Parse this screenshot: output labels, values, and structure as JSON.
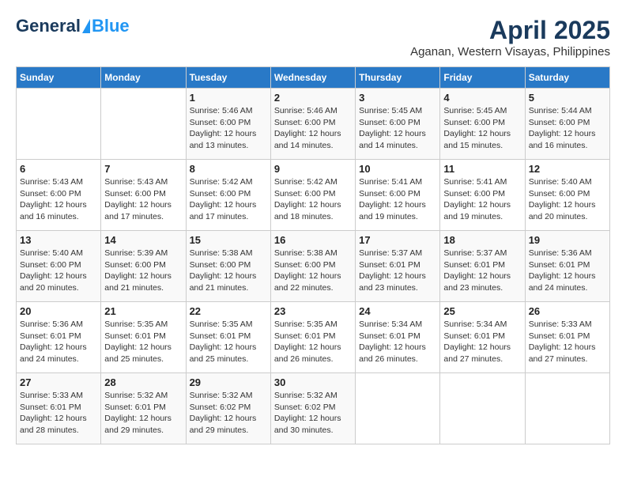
{
  "logo": {
    "part1": "General",
    "part2": "Blue"
  },
  "title": "April 2025",
  "subtitle": "Aganan, Western Visayas, Philippines",
  "headers": [
    "Sunday",
    "Monday",
    "Tuesday",
    "Wednesday",
    "Thursday",
    "Friday",
    "Saturday"
  ],
  "weeks": [
    [
      {
        "day": "",
        "info": ""
      },
      {
        "day": "",
        "info": ""
      },
      {
        "day": "1",
        "info": "Sunrise: 5:46 AM\nSunset: 6:00 PM\nDaylight: 12 hours\nand 13 minutes."
      },
      {
        "day": "2",
        "info": "Sunrise: 5:46 AM\nSunset: 6:00 PM\nDaylight: 12 hours\nand 14 minutes."
      },
      {
        "day": "3",
        "info": "Sunrise: 5:45 AM\nSunset: 6:00 PM\nDaylight: 12 hours\nand 14 minutes."
      },
      {
        "day": "4",
        "info": "Sunrise: 5:45 AM\nSunset: 6:00 PM\nDaylight: 12 hours\nand 15 minutes."
      },
      {
        "day": "5",
        "info": "Sunrise: 5:44 AM\nSunset: 6:00 PM\nDaylight: 12 hours\nand 16 minutes."
      }
    ],
    [
      {
        "day": "6",
        "info": "Sunrise: 5:43 AM\nSunset: 6:00 PM\nDaylight: 12 hours\nand 16 minutes."
      },
      {
        "day": "7",
        "info": "Sunrise: 5:43 AM\nSunset: 6:00 PM\nDaylight: 12 hours\nand 17 minutes."
      },
      {
        "day": "8",
        "info": "Sunrise: 5:42 AM\nSunset: 6:00 PM\nDaylight: 12 hours\nand 17 minutes."
      },
      {
        "day": "9",
        "info": "Sunrise: 5:42 AM\nSunset: 6:00 PM\nDaylight: 12 hours\nand 18 minutes."
      },
      {
        "day": "10",
        "info": "Sunrise: 5:41 AM\nSunset: 6:00 PM\nDaylight: 12 hours\nand 19 minutes."
      },
      {
        "day": "11",
        "info": "Sunrise: 5:41 AM\nSunset: 6:00 PM\nDaylight: 12 hours\nand 19 minutes."
      },
      {
        "day": "12",
        "info": "Sunrise: 5:40 AM\nSunset: 6:00 PM\nDaylight: 12 hours\nand 20 minutes."
      }
    ],
    [
      {
        "day": "13",
        "info": "Sunrise: 5:40 AM\nSunset: 6:00 PM\nDaylight: 12 hours\nand 20 minutes."
      },
      {
        "day": "14",
        "info": "Sunrise: 5:39 AM\nSunset: 6:00 PM\nDaylight: 12 hours\nand 21 minutes."
      },
      {
        "day": "15",
        "info": "Sunrise: 5:38 AM\nSunset: 6:00 PM\nDaylight: 12 hours\nand 21 minutes."
      },
      {
        "day": "16",
        "info": "Sunrise: 5:38 AM\nSunset: 6:00 PM\nDaylight: 12 hours\nand 22 minutes."
      },
      {
        "day": "17",
        "info": "Sunrise: 5:37 AM\nSunset: 6:01 PM\nDaylight: 12 hours\nand 23 minutes."
      },
      {
        "day": "18",
        "info": "Sunrise: 5:37 AM\nSunset: 6:01 PM\nDaylight: 12 hours\nand 23 minutes."
      },
      {
        "day": "19",
        "info": "Sunrise: 5:36 AM\nSunset: 6:01 PM\nDaylight: 12 hours\nand 24 minutes."
      }
    ],
    [
      {
        "day": "20",
        "info": "Sunrise: 5:36 AM\nSunset: 6:01 PM\nDaylight: 12 hours\nand 24 minutes."
      },
      {
        "day": "21",
        "info": "Sunrise: 5:35 AM\nSunset: 6:01 PM\nDaylight: 12 hours\nand 25 minutes."
      },
      {
        "day": "22",
        "info": "Sunrise: 5:35 AM\nSunset: 6:01 PM\nDaylight: 12 hours\nand 25 minutes."
      },
      {
        "day": "23",
        "info": "Sunrise: 5:35 AM\nSunset: 6:01 PM\nDaylight: 12 hours\nand 26 minutes."
      },
      {
        "day": "24",
        "info": "Sunrise: 5:34 AM\nSunset: 6:01 PM\nDaylight: 12 hours\nand 26 minutes."
      },
      {
        "day": "25",
        "info": "Sunrise: 5:34 AM\nSunset: 6:01 PM\nDaylight: 12 hours\nand 27 minutes."
      },
      {
        "day": "26",
        "info": "Sunrise: 5:33 AM\nSunset: 6:01 PM\nDaylight: 12 hours\nand 27 minutes."
      }
    ],
    [
      {
        "day": "27",
        "info": "Sunrise: 5:33 AM\nSunset: 6:01 PM\nDaylight: 12 hours\nand 28 minutes."
      },
      {
        "day": "28",
        "info": "Sunrise: 5:32 AM\nSunset: 6:01 PM\nDaylight: 12 hours\nand 29 minutes."
      },
      {
        "day": "29",
        "info": "Sunrise: 5:32 AM\nSunset: 6:02 PM\nDaylight: 12 hours\nand 29 minutes."
      },
      {
        "day": "30",
        "info": "Sunrise: 5:32 AM\nSunset: 6:02 PM\nDaylight: 12 hours\nand 30 minutes."
      },
      {
        "day": "",
        "info": ""
      },
      {
        "day": "",
        "info": ""
      },
      {
        "day": "",
        "info": ""
      }
    ]
  ]
}
